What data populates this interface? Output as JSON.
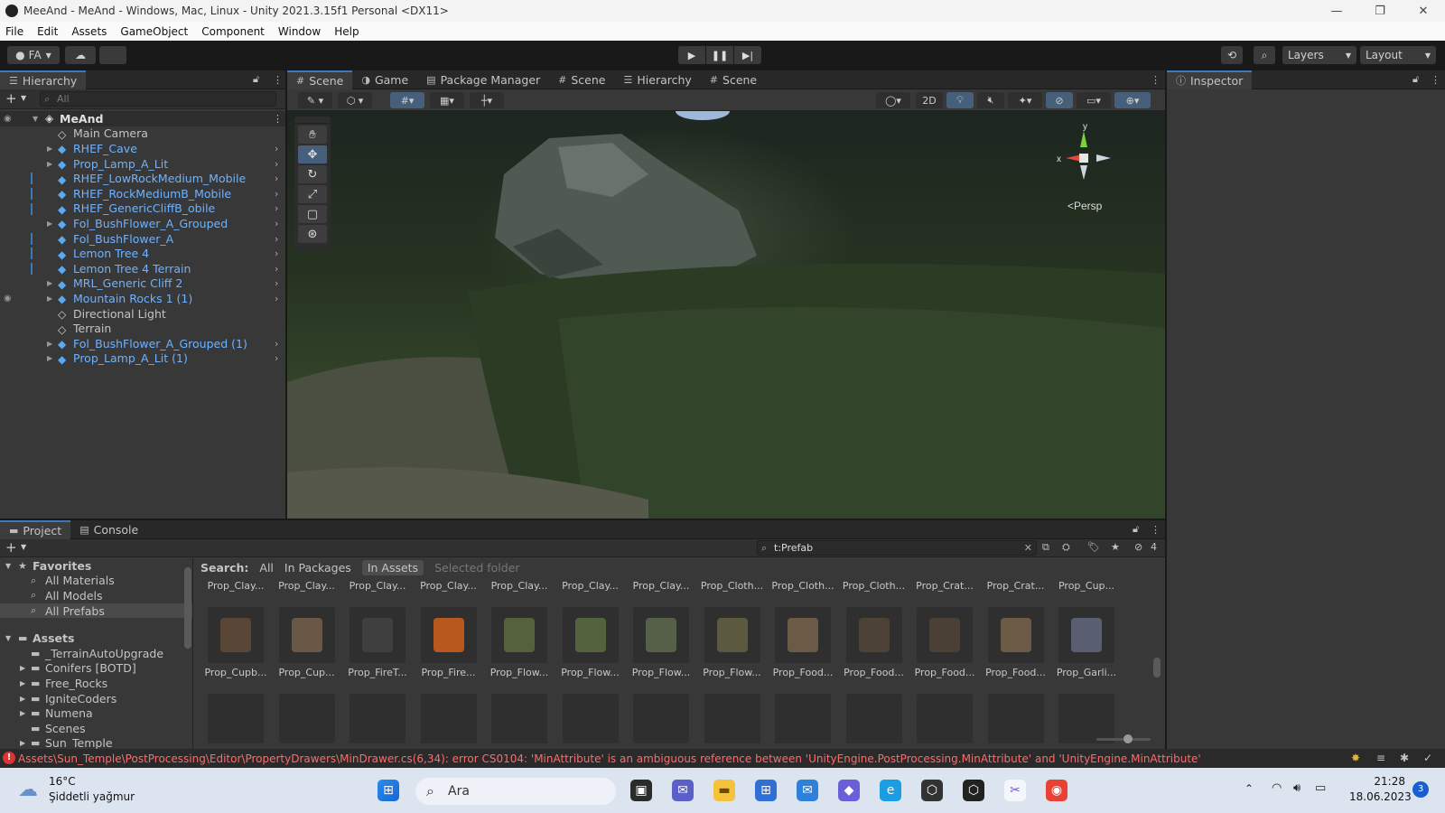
{
  "window": {
    "title": "MeeAnd - MeAnd - Windows, Mac, Linux - Unity 2021.3.15f1 Personal <DX11>",
    "controls": [
      "—",
      "❐",
      "✕"
    ]
  },
  "menu": [
    "File",
    "Edit",
    "Assets",
    "GameObject",
    "Component",
    "Window",
    "Help"
  ],
  "toolbar": {
    "account": "FA",
    "layers": "Layers",
    "layout": "Layout"
  },
  "hierarchy": {
    "tab": "Hierarchy",
    "search_placeholder": "All",
    "scene_name": "MeAnd",
    "items": [
      {
        "label": "Main Camera",
        "prefab": false,
        "expand": false
      },
      {
        "label": "RHEF_Cave",
        "prefab": true,
        "expand": true
      },
      {
        "label": "Prop_Lamp_A_Lit",
        "prefab": true,
        "expand": true
      },
      {
        "label": "RHEF_LowRockMedium_Mobile",
        "prefab": true,
        "expand": false
      },
      {
        "label": "RHEF_RockMediumB_Mobile",
        "prefab": true,
        "expand": false
      },
      {
        "label": "RHEF_GenericCliffB_obile",
        "prefab": true,
        "expand": false
      },
      {
        "label": "Fol_BushFlower_A_Grouped",
        "prefab": true,
        "expand": true
      },
      {
        "label": "Fol_BushFlower_A",
        "prefab": true,
        "expand": false
      },
      {
        "label": "Lemon Tree 4",
        "prefab": true,
        "expand": false
      },
      {
        "label": "Lemon Tree 4 Terrain",
        "prefab": true,
        "expand": false
      },
      {
        "label": "MRL_Generic Cliff 2",
        "prefab": true,
        "expand": true
      },
      {
        "label": "Mountain Rocks 1 (1)",
        "prefab": true,
        "expand": true
      },
      {
        "label": "Directional Light",
        "prefab": false,
        "expand": false
      },
      {
        "label": "Terrain",
        "prefab": false,
        "expand": false
      },
      {
        "label": "Fol_BushFlower_A_Grouped (1)",
        "prefab": true,
        "expand": true
      },
      {
        "label": "Prop_Lamp_A_Lit (1)",
        "prefab": true,
        "expand": true
      }
    ]
  },
  "scene_tabs": [
    "Scene",
    "Game",
    "Package Manager",
    "Scene",
    "Hierarchy",
    "Scene"
  ],
  "scene": {
    "mode_2d": "2D",
    "persp": "<Persp",
    "axis_y": "y",
    "axis_x": "x"
  },
  "inspector": {
    "tab": "Inspector"
  },
  "project": {
    "tabs": [
      "Project",
      "Console"
    ],
    "search_value": "t:Prefab",
    "hidden_count": "4",
    "search_label": "Search:",
    "filters": [
      "All",
      "In Packages",
      "In Assets",
      "Selected folder"
    ],
    "favorites_label": "Favorites",
    "favorites": [
      "All Materials",
      "All Models",
      "All Prefabs"
    ],
    "assets_label": "Assets",
    "folders": [
      "_TerrainAutoUpgrade",
      "Conifers [BOTD]",
      "Free_Rocks",
      "IgniteCoders",
      "Numena",
      "Scenes",
      "Sun_Temple"
    ],
    "row1": [
      "Prop_Clay...",
      "Prop_Clay...",
      "Prop_Clay...",
      "Prop_Clay...",
      "Prop_Clay...",
      "Prop_Clay...",
      "Prop_Clay...",
      "Prop_Cloth...",
      "Prop_Cloth...",
      "Prop_Cloth...",
      "Prop_Crat...",
      "Prop_Crat...",
      "Prop_Cup..."
    ],
    "row2": [
      "Prop_Cupb...",
      "Prop_Cup...",
      "Prop_FireT...",
      "Prop_Fire...",
      "Prop_Flow...",
      "Prop_Flow...",
      "Prop_Flow...",
      "Prop_Flow...",
      "Prop_Food...",
      "Prop_Food...",
      "Prop_Food...",
      "Prop_Food...",
      "Prop_Garli..."
    ]
  },
  "status": {
    "error": "Assets\\Sun_Temple\\PostProcessing\\Editor\\PropertyDrawers\\MinDrawer.cs(6,34): error CS0104: 'MinAttribute' is an ambiguous reference between 'UnityEngine.PostProcessing.MinAttribute' and 'UnityEngine.MinAttribute'"
  },
  "taskbar": {
    "temperature": "16°C",
    "weather": "Şiddetli yağmur",
    "search": "Ara",
    "time": "21:28",
    "date": "18.06.2023",
    "notifications": "3"
  },
  "colors": {
    "accent": "#3a79bb",
    "prefab_blue": "#6fb2ff",
    "error_red": "#ff6a6a"
  }
}
